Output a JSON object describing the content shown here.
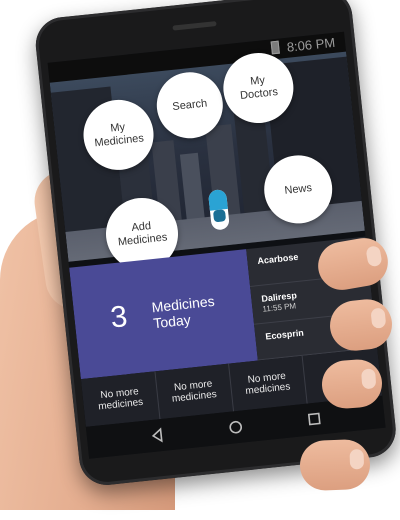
{
  "status_bar": {
    "time": "8:06 PM"
  },
  "menu": {
    "my_medicines": "My Medicines",
    "search": "Search",
    "my_doctors": "My Doctors",
    "news": "News",
    "add_medicines": "Add Medicines"
  },
  "today": {
    "count": "3",
    "label": "Medicines Today"
  },
  "side_list": [
    {
      "name": "Acarbose",
      "time": ""
    },
    {
      "name": "Daliresp",
      "time": "11:55 PM"
    },
    {
      "name": "Ecosprin",
      "time": ""
    }
  ],
  "no_more_cells": [
    "No more medicines",
    "No more medicines",
    "No more medicines"
  ],
  "colors": {
    "today_tile": "#4a4a96",
    "bubble": "#ffffff",
    "pill_blue": "#2aa3d4"
  },
  "icons": [
    "battery-icon",
    "pill-icon",
    "back-icon",
    "home-icon",
    "recents-icon"
  ]
}
